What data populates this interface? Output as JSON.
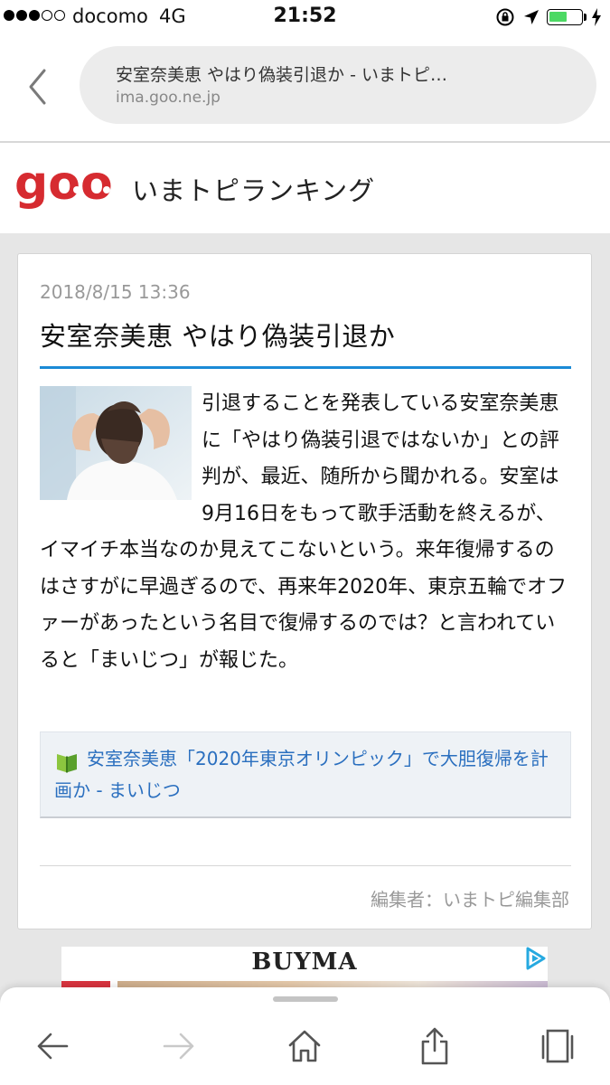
{
  "status_bar": {
    "carrier": "docomo",
    "network": "4G",
    "time": "21:52",
    "signal_bars_filled": 3,
    "signal_bars_total": 5,
    "battery_level": 0.5,
    "icons": [
      "rotation-lock-icon",
      "location-arrow-icon",
      "battery-icon",
      "charging-bolt-icon"
    ]
  },
  "browser": {
    "page_title": "安室奈美恵 やはり偽装引退か - いまトピ…",
    "domain": "ima.goo.ne.jp"
  },
  "site_header": {
    "logo_text": "goo",
    "subtitle": "いまトピランキング",
    "logo_color": "#d62b30"
  },
  "article": {
    "date": "2018/8/15 13:36",
    "title": "安室奈美恵 やはり偽装引退か",
    "body": "引退することを発表している安室奈美恵に「やはり偽装引退ではないか」との評判が、最近、随所から聞かれる。安室は9月16日をもって歌手活動を終えるが、イマイチ本当なのか見えてこないという。来年復帰するのはさすがに早過ぎるので、再来年2020年、東京五輪でオファーがあったという名目で復帰するのでは？と言われていると「まいじつ」が報じた。",
    "related_link": "安室奈美恵「2020年東京オリンピック」で大胆復帰を計画か - まいじつ",
    "editor": "編集者：いまトピ編集部",
    "accent_color": "#1a8ad6",
    "link_color": "#2a6fbf"
  },
  "ad": {
    "brand": "BUYMA"
  },
  "toolbar": {
    "buttons": [
      "back-arrow-icon",
      "forward-arrow-icon",
      "home-icon",
      "share-icon",
      "tabs-icon"
    ]
  }
}
